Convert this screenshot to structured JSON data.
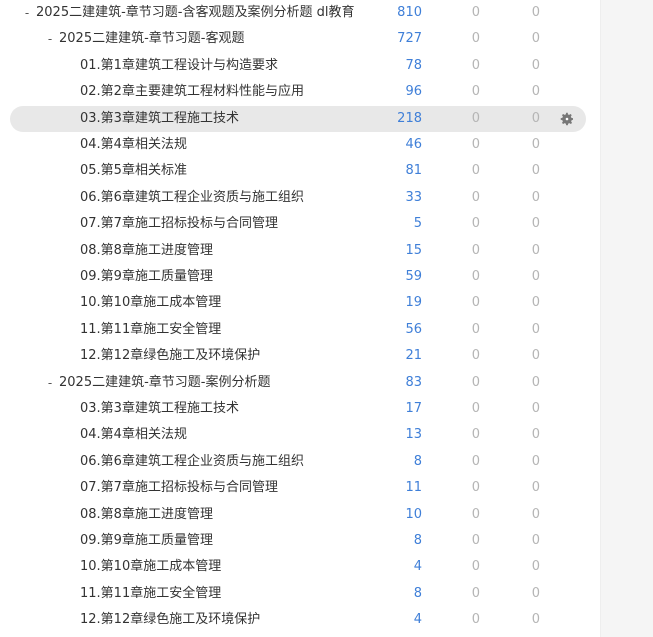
{
  "rows": [
    {
      "toggle": "-",
      "label": "2025二建建筑-章节习题-含客观题及案例分析题 dl教育",
      "count": "810",
      "col2": "0",
      "col3": "0"
    },
    {
      "toggle": "-",
      "label": "2025二建建筑-章节习题-客观题",
      "count": "727",
      "col2": "0",
      "col3": "0"
    },
    {
      "label": "01.第1章建筑工程设计与构造要求",
      "count": "78",
      "col2": "0",
      "col3": "0"
    },
    {
      "label": "02.第2章主要建筑工程材料性能与应用",
      "count": "96",
      "col2": "0",
      "col3": "0"
    },
    {
      "label": "03.第3章建筑工程施工技术",
      "count": "218",
      "col2": "0",
      "col3": "0"
    },
    {
      "label": "04.第4章相关法规",
      "count": "46",
      "col2": "0",
      "col3": "0"
    },
    {
      "label": "05.第5章相关标准",
      "count": "81",
      "col2": "0",
      "col3": "0"
    },
    {
      "label": "06.第6章建筑工程企业资质与施工组织",
      "count": "33",
      "col2": "0",
      "col3": "0"
    },
    {
      "label": "07.第7章施工招标投标与合同管理",
      "count": "5",
      "col2": "0",
      "col3": "0"
    },
    {
      "label": "08.第8章施工进度管理",
      "count": "15",
      "col2": "0",
      "col3": "0"
    },
    {
      "label": "09.第9章施工质量管理",
      "count": "59",
      "col2": "0",
      "col3": "0"
    },
    {
      "label": "10.第10章施工成本管理",
      "count": "19",
      "col2": "0",
      "col3": "0"
    },
    {
      "label": "11.第11章施工安全管理",
      "count": "56",
      "col2": "0",
      "col3": "0"
    },
    {
      "label": "12.第12章绿色施工及环境保护",
      "count": "21",
      "col2": "0",
      "col3": "0"
    },
    {
      "toggle": "-",
      "label": "2025二建建筑-章节习题-案例分析题",
      "count": "83",
      "col2": "0",
      "col3": "0"
    },
    {
      "label": "03.第3章建筑工程施工技术",
      "count": "17",
      "col2": "0",
      "col3": "0"
    },
    {
      "label": "04.第4章相关法规",
      "count": "13",
      "col2": "0",
      "col3": "0"
    },
    {
      "label": "06.第6章建筑工程企业资质与施工组织",
      "count": "8",
      "col2": "0",
      "col3": "0"
    },
    {
      "label": "07.第7章施工招标投标与合同管理",
      "count": "11",
      "col2": "0",
      "col3": "0"
    },
    {
      "label": "08.第8章施工进度管理",
      "count": "10",
      "col2": "0",
      "col3": "0"
    },
    {
      "label": "09.第9章施工质量管理",
      "count": "8",
      "col2": "0",
      "col3": "0"
    },
    {
      "label": "10.第10章施工成本管理",
      "count": "4",
      "col2": "0",
      "col3": "0"
    },
    {
      "label": "11.第11章施工安全管理",
      "count": "8",
      "col2": "0",
      "col3": "0"
    },
    {
      "label": "12.第12章绿色施工及环境保护",
      "count": "4",
      "col2": "0",
      "col3": "0"
    }
  ],
  "selected_row": 4,
  "icons": {
    "row_action": "gear-icon"
  },
  "colors": {
    "count": "#3f7fd8",
    "muted": "#b5b5b5",
    "selected_bg": "#e8e8e8"
  }
}
